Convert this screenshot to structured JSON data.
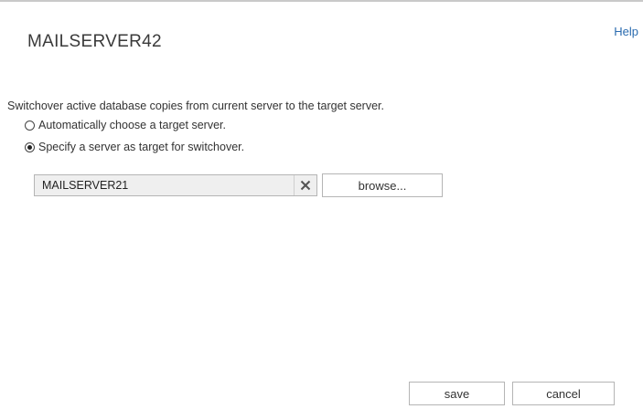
{
  "header": {
    "title": "MAILSERVER42",
    "help_label": "Help"
  },
  "form": {
    "instruction": "Switchover active database copies from current server to the target server.",
    "options": [
      {
        "label": "Automatically choose a target server.",
        "selected": false
      },
      {
        "label": "Specify a server as target for switchover.",
        "selected": true
      }
    ],
    "target_server_value": "MAILSERVER21",
    "browse_label": "browse..."
  },
  "footer": {
    "save_label": "save",
    "cancel_label": "cancel"
  },
  "colors": {
    "link": "#2b6cb0",
    "input_background": "#efefef",
    "border": "#b5b5b5"
  }
}
